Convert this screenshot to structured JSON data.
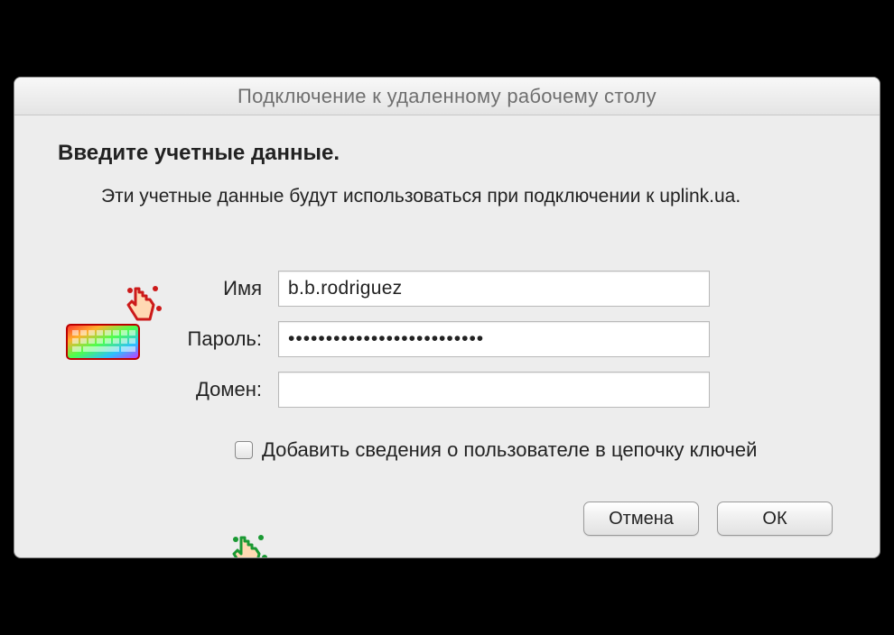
{
  "window": {
    "title": "Подключение к удаленному рабочему столу"
  },
  "dialog": {
    "heading": "Введите учетные данные.",
    "description": "Эти учетные данные будут использоваться при подключении к uplink.ua."
  },
  "form": {
    "username": {
      "label": "Имя",
      "value": "b.b.rodriguez"
    },
    "password": {
      "label": "Пароль:",
      "value": "••••••••••••••••••••••••••"
    },
    "domain": {
      "label": "Домен:",
      "value": ""
    },
    "keychain": {
      "label": "Добавить сведения о пользователе в цепочку ключей",
      "checked": false
    }
  },
  "buttons": {
    "cancel": "Отмена",
    "ok": "ОК"
  },
  "icons": {
    "keyboard": "keyboard-icon",
    "pointer": "hand-pointer-icon"
  }
}
